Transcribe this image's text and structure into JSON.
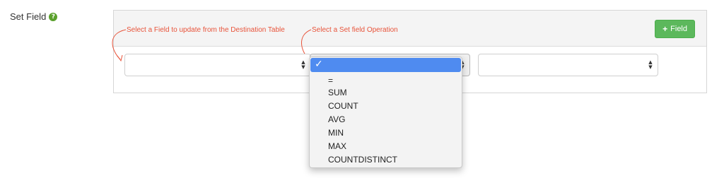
{
  "field": {
    "label": "Set Field",
    "help_glyph": "?"
  },
  "annotations": {
    "destination_field": "Select a Field to update from the Destination Table",
    "operation": "Select a Set field Operation"
  },
  "add_button": {
    "plus": "+",
    "label": "Field"
  },
  "selects": {
    "destination_field_value": "",
    "operation_value": "",
    "value_field_value": ""
  },
  "dropdown": {
    "selected_check": "✓",
    "options": [
      "=",
      "SUM",
      "COUNT",
      "AVG",
      "MIN",
      "MAX",
      "COUNTDISTINCT"
    ]
  },
  "colors": {
    "annotation": "#e8533a",
    "button": "#5cb85c",
    "selection": "#4f8bf0"
  }
}
